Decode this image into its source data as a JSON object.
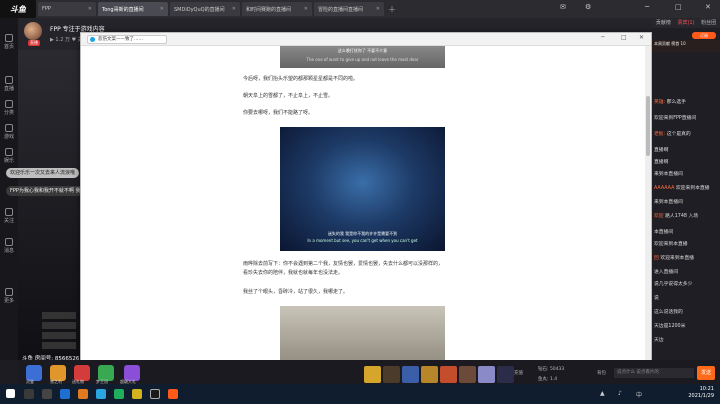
{
  "tabs": [
    {
      "label": "FPP"
    },
    {
      "label": "Tong哥新的直播间"
    },
    {
      "label": "SMDiDyQuQ的直播间"
    },
    {
      "label": "和时间赛跑的直播间"
    },
    {
      "label": "冒险的直播间直播间"
    }
  ],
  "stream": {
    "title": "FPP 专注于游戏内容",
    "meta": "▶ 1.2 万  ♥ 关注  FPP",
    "badge": "直播"
  },
  "left_strip": [
    {
      "label": "首页"
    },
    {
      "label": "直播"
    },
    {
      "label": "分类"
    },
    {
      "label": "游戏"
    },
    {
      "label": "娱乐"
    },
    {
      "label": "关注"
    },
    {
      "label": "消息"
    },
    {
      "label": "更多"
    }
  ],
  "bullets": [
    {
      "text": "欢迎乐乐一次又去来人流浪哦"
    },
    {
      "text": "FPP为我心我和我开不就不啊 我上去 去看我那边一个卡一个"
    }
  ],
  "viewers": "斗鱼 房间号: 8566526",
  "modal": {
    "title": "悲伤文案——致了……",
    "img1_caption_top": "这么晚打扰你了 不要不介意",
    "img1_caption_bottom": "The one of want to give up and not leave the most dear",
    "p1": "今后呀，我们抬头乐望的都那颗星星都是不同的啦。",
    "p2": "朝天阜上的雪都了，不止阜上，不止雪。",
    "p3": "你要去哪呀，我们不能路了呀。",
    "img2_caption_cn": "迷失的我 我是你不我的许许是需要不到",
    "img2_caption_en": "In a moment but see, you can't get when you can't get",
    "p4": "雨哗除去前写下：你不会遇到第二个我，友情也罢，爱情也罢，失去什么都可以没那样的，",
    "p4b": "看珍失去你的陪伴，我就也就每年也没法走。",
    "p5": "我丝了个眼头，昏砖冷，站了很久，我哪走了。"
  },
  "right_panel": {
    "tabs": [
      "贡献榜",
      "贵宾(1)",
      "粉丝团"
    ],
    "subscribe": "订阅",
    "topuser": "本周贡献 榜首 10",
    "chat": [
      {
        "name": "英雄:",
        "text": " 那么选手"
      },
      {
        "name": "",
        "text": "欢迎来到FPP直播间"
      },
      {
        "name": "老板:",
        "text": " 这个是真的"
      },
      {
        "name": "",
        "text": "直播啊"
      },
      {
        "name": "",
        "text": "直播啊"
      },
      {
        "name": "",
        "text": "来到本直播间"
      },
      {
        "name": "AAAAAA",
        "text": " 欢迎来到本直播"
      },
      {
        "name": "",
        "text": "来到本直播间"
      },
      {
        "name": "欢迎",
        "text": " 路人1748 入场"
      },
      {
        "name": "",
        "text": "本直播间"
      },
      {
        "name": "",
        "text": "欢迎来到本直播"
      },
      {
        "name": "回",
        "text": " 欢迎来到本直播"
      },
      {
        "name": "",
        "text": "进入直播间"
      },
      {
        "name": "",
        "text": "说几乎说得太多少"
      },
      {
        "name": "",
        "text": "说"
      },
      {
        "name": "",
        "text": "这么说话我的"
      },
      {
        "name": "",
        "text": "天边是1200米"
      },
      {
        "name": "",
        "text": "天边"
      }
    ],
    "input_placeholder": "说点什么 说点看片的",
    "send": "发送"
  },
  "bottom": {
    "gifts": [
      {
        "label": "灵鉴"
      },
      {
        "label": "铁之利"
      },
      {
        "label": "送礼物"
      },
      {
        "label": "梦王冠"
      },
      {
        "label": "超级大礼"
      }
    ],
    "misc": [
      "充值",
      "钻石: 50433",
      "鱼丸: 1.4",
      "背包"
    ]
  },
  "taskbar": {
    "time": "10:21",
    "date": "2021/1/29"
  }
}
